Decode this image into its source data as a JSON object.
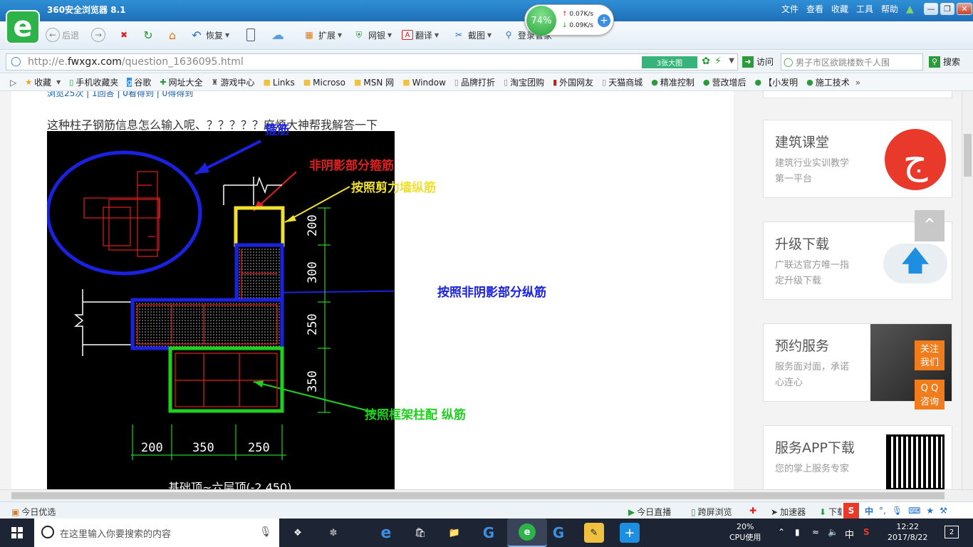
{
  "window": {
    "title": "360安全浏览器 8.1",
    "menu": [
      "文件",
      "查看",
      "收藏",
      "工具",
      "帮助"
    ]
  },
  "speed": {
    "percent": "74%",
    "up": "0.07K/s",
    "down": "0.09K/s"
  },
  "toolbar": {
    "back": "后退",
    "restore": "恢复",
    "extend": "扩展",
    "netbank": "网银",
    "translate": "翻译",
    "screenshot": "截图",
    "login": "登录管家"
  },
  "address": {
    "url_prefix": "http://e.",
    "url_domain": "fwxgx.com",
    "url_path": "/question_1636095.html",
    "big_image": "3张大图",
    "visit": "访问",
    "search_placeholder": "男子市区欲跳楼数千人围",
    "search_button": "搜索"
  },
  "bookmarks": [
    {
      "label": "收藏",
      "icon": "star-icon"
    },
    {
      "label": "手机收藏夹",
      "icon": "phone-icon"
    },
    {
      "label": "谷歌",
      "icon": "google-icon"
    },
    {
      "label": "网址大全",
      "icon": "plus-icon"
    },
    {
      "label": "游戏中心",
      "icon": "gamepad-icon"
    },
    {
      "label": "Links",
      "icon": "folder-icon"
    },
    {
      "label": "Microso",
      "icon": "folder-icon"
    },
    {
      "label": "MSN 网",
      "icon": "folder-icon"
    },
    {
      "label": "Window",
      "icon": "folder-icon"
    },
    {
      "label": "品牌打折",
      "icon": "page-icon"
    },
    {
      "label": "淘宝团购",
      "icon": "page-icon"
    },
    {
      "label": "外国网友",
      "icon": "flag-icon"
    },
    {
      "label": "天猫商城",
      "icon": "page-icon"
    },
    {
      "label": "精准控制",
      "icon": "chat-icon"
    },
    {
      "label": "营改增后",
      "icon": "chat-icon"
    },
    {
      "label": "【小发明",
      "icon": "chat-icon"
    },
    {
      "label": "施工技术",
      "icon": "chat-icon"
    }
  ],
  "page": {
    "top_meta": "浏览25次 | 1回答 | 0看得到 | 0得得到",
    "question": "这种柱子钢筋信息怎么输入呢、？？？？？麻烦大神帮我解答一下"
  },
  "cad": {
    "label_stirrup": "箍筋",
    "label_nonshadow_stirrup": "非阴影部分箍筋",
    "label_shear_wall": "按照剪力墙纵筋",
    "label_nonshadow_rebar": "按照非阴影部分纵筋",
    "label_frame_col": "按照框架柱配 纵筋",
    "dims_right": [
      "200",
      "300",
      "250",
      "350"
    ],
    "dims_bottom": [
      "200",
      "350",
      "250"
    ],
    "bottom_text": "基础顶~六层顶(-2.450)"
  },
  "sidebar": [
    {
      "title": "建筑课堂",
      "desc": "建筑行业实训教学第一平台"
    },
    {
      "title": "升级下载",
      "desc": "广联达官方唯一指定升级下载"
    },
    {
      "title": "预约服务",
      "desc": "服务面对面，承诺心连心"
    },
    {
      "title": "服务APP下载",
      "desc": "您的掌上服务专家"
    }
  ],
  "float": {
    "follow": "关注我们",
    "qq": "Q Q 咨询"
  },
  "status": {
    "today_picks": "今日优选",
    "live": "今日直播",
    "cross_screen": "跨屏浏览",
    "accelerator": "加速器",
    "download": "下载",
    "ime": "中"
  },
  "taskbar": {
    "search_placeholder": "在这里输入你要搜索的内容",
    "cpu_percent": "20%",
    "cpu_label": "CPU使用",
    "lang": "中",
    "time": "12:22",
    "date": "2017/8/22",
    "notifications": "2"
  }
}
